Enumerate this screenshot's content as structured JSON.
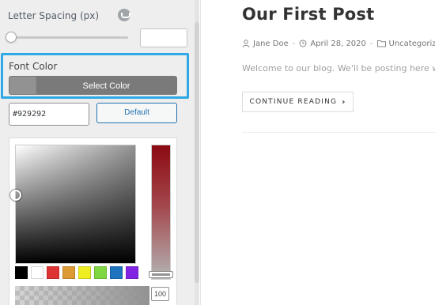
{
  "customizer": {
    "letter_spacing": {
      "label": "Letter Spacing (px)",
      "reset_icon": "reset-icon",
      "slider_value": 0,
      "value": ""
    },
    "font_color": {
      "label": "Font Color",
      "button_label": "Select Color",
      "current_color": "#929292"
    },
    "color_picker": {
      "hex_value": "#929292",
      "default_label": "Default",
      "palette": [
        "#000000",
        "#ffffff",
        "#dd3333",
        "#dd9933",
        "#eeee22",
        "#81d742",
        "#1e73be",
        "#8224e3"
      ],
      "alpha_value": "100",
      "accent_color": "#2271b1",
      "highlight_color": "#2ea8e6"
    }
  },
  "post": {
    "title": "Our First Post",
    "author": "Jane Doe",
    "date": "April 28, 2020",
    "category": "Uncategorized",
    "excerpt": "Welcome to our blog. We'll be posting here w",
    "continue_label": "CONTINUE READING",
    "continue_icon": "chevron-right-icon"
  }
}
